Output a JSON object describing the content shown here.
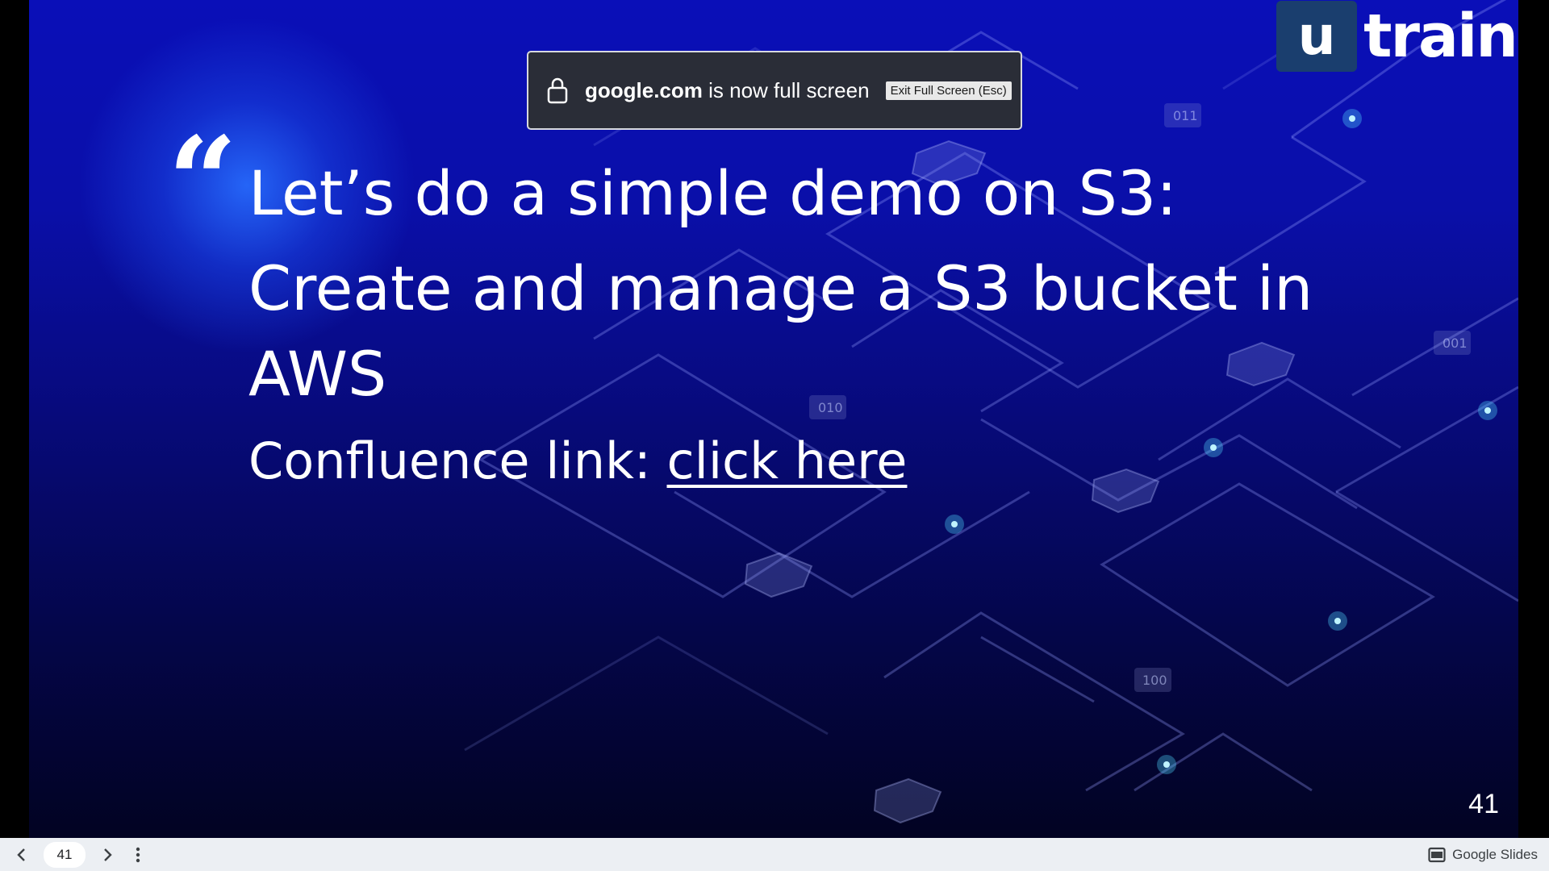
{
  "fullscreen_notice": {
    "domain": "google.com",
    "message": " is now full screen",
    "exit_label": "Exit Full Screen (Esc)"
  },
  "slide": {
    "logo_letter": "u",
    "logo_word": "train",
    "quote_mark": "“",
    "line1": "Let’s do a simple demo on S3:",
    "line2": "Create and manage a S3 bucket in AWS",
    "line3_prefix": "Confluence link: ",
    "link_text": "click here",
    "slide_number": "41",
    "bubble_labels": [
      "011",
      "001",
      "010",
      "100"
    ]
  },
  "toolbar": {
    "page_value": "41",
    "brand_label": "Google Slides"
  },
  "colors": {
    "slide_bg_top": "#0a0fb8",
    "slide_bg_bottom": "#020322",
    "logo_box": "#1a3e6e",
    "toast_bg": "#2a2d37",
    "toolbar_bg": "#eceff3",
    "node_glow": "#4fd6ff"
  },
  "icons": {
    "prev": "chevron-left-icon",
    "next": "chevron-right-icon",
    "more": "more-vert-icon",
    "lock": "lock-icon",
    "brand": "slides-icon"
  }
}
